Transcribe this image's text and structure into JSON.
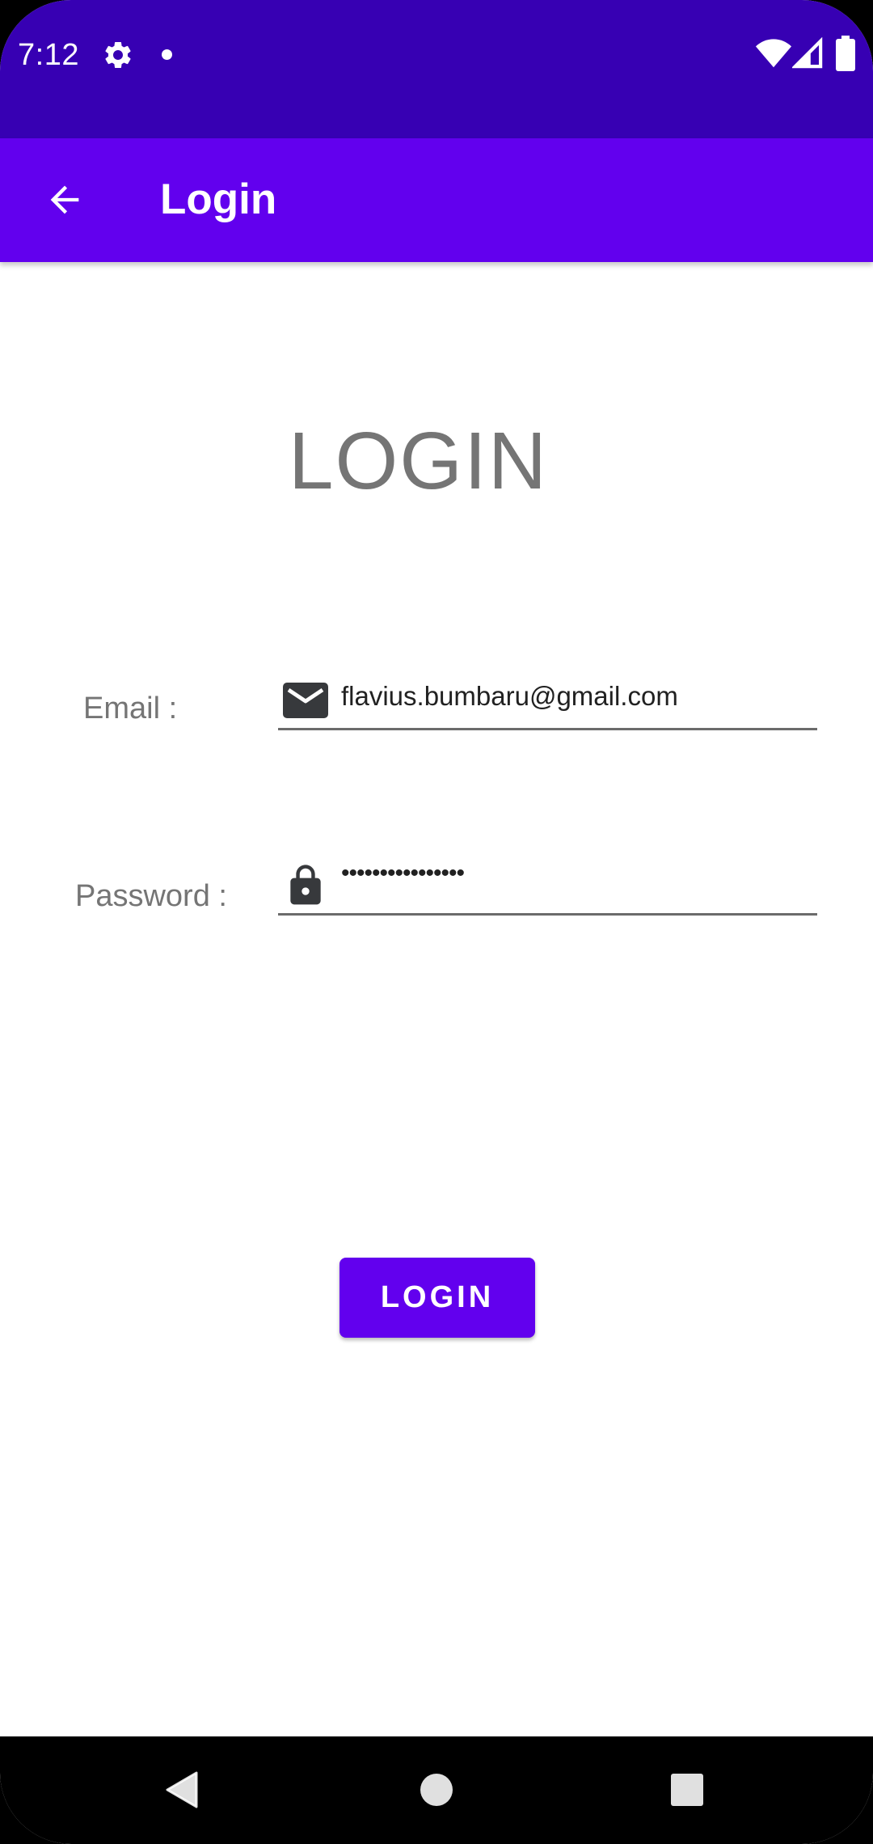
{
  "status_bar": {
    "time": "7:12",
    "icons": [
      "settings-gear-icon",
      "notification-dot-icon",
      "wifi-icon",
      "cell-signal-icon",
      "battery-icon"
    ]
  },
  "app_bar": {
    "back_icon": "arrow-back-icon",
    "title": "Login"
  },
  "form": {
    "heading": "LOGIN",
    "email": {
      "label": "Email :",
      "icon": "email-envelope-icon",
      "value": "flavius.bumbaru@gmail.com"
    },
    "password": {
      "label": "Password :",
      "icon": "lock-icon",
      "value": "••••••••••••••••"
    },
    "submit_label": "LOGIN"
  },
  "nav_bar": {
    "icons": [
      "nav-back-icon",
      "nav-home-icon",
      "nav-recents-icon"
    ]
  },
  "colors": {
    "status_bar": "#3700b3",
    "app_bar": "#6200ee",
    "button": "#6200ee",
    "label_text": "#757575",
    "value_text": "#212121",
    "icon_dark": "#37393c"
  }
}
